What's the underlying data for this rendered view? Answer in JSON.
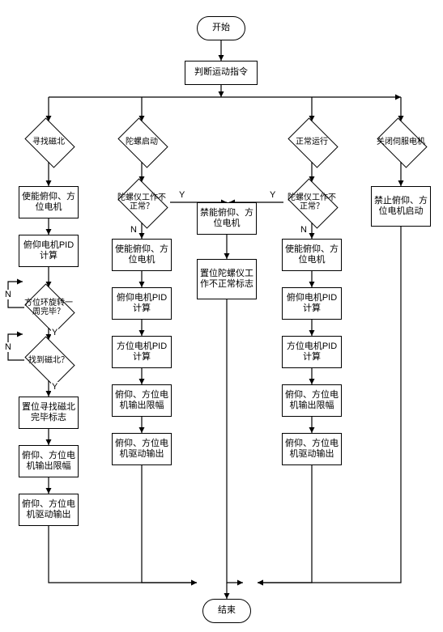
{
  "chart_data": {
    "type": "flowchart",
    "title": "",
    "nodes": {
      "start": "开始",
      "judge": "判断运动指令",
      "end": "结束",
      "branch1": {
        "d1": "寻找磁北",
        "r1_1": "使能俯仰、方位电机",
        "r1_2": "俯仰电机PID计算",
        "d1_3": "方位环旋转一周完毕？",
        "d1_4": "找到磁北？",
        "r1_5": "置位寻找磁北完毕标志",
        "r1_6": "俯仰、方位电机输出限幅",
        "r1_7": "俯仰、方位电机驱动输出"
      },
      "branch2": {
        "d2": "陀螺启动",
        "d2_1": "陀螺仪工作不正常？",
        "r2_2": "使能俯仰、方位电机",
        "r2_3": "俯仰电机PID计算",
        "r2_4": "方位电机PID计算",
        "r2_5": "俯仰、方位电机输出限幅",
        "r2_6": "俯仰、方位电机驱动输出"
      },
      "center": {
        "rc_1": "禁能俯仰、方位电机",
        "rc_2": "置位陀螺仪工作不正常标志"
      },
      "branch3": {
        "d3": "正常运行",
        "d3_1": "陀螺仪工作不正常？",
        "r3_2": "使能俯仰、方位电机",
        "r3_3": "俯仰电机PID计算",
        "r3_4": "方位电机PID计算",
        "r3_5": "俯仰、方位电机输出限幅",
        "r3_6": "俯仰、方位电机驱动输出"
      },
      "branch4": {
        "d4": "关闭伺服电机",
        "r4_1": "禁止俯仰、方位电机启动"
      }
    },
    "labels": {
      "yes": "Y",
      "no": "N"
    }
  }
}
